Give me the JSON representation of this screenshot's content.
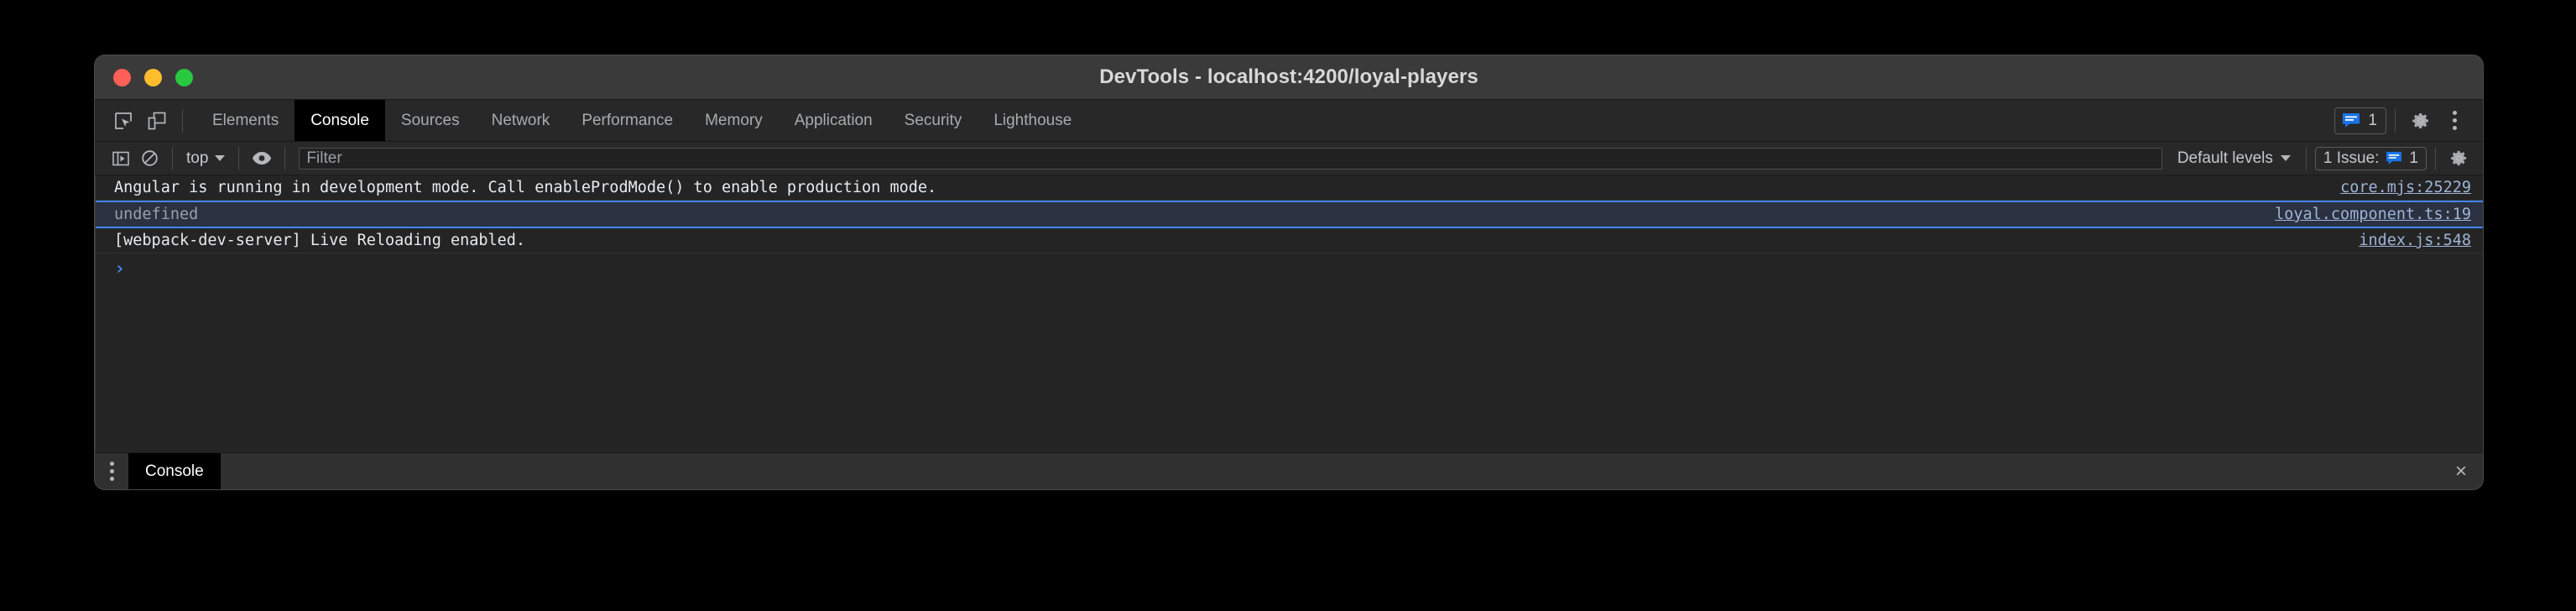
{
  "window": {
    "title": "DevTools - localhost:4200/loyal-players",
    "traffic_lights": [
      {
        "name": "close",
        "color": "#ff5f57"
      },
      {
        "name": "minimize",
        "color": "#ffbd2e"
      },
      {
        "name": "maximize",
        "color": "#28c840"
      }
    ]
  },
  "tabbar": {
    "inspect_icon": "inspect-element-icon",
    "device_icon": "device-toolbar-icon",
    "tabs": [
      {
        "label": "Elements",
        "active": false
      },
      {
        "label": "Console",
        "active": true
      },
      {
        "label": "Sources",
        "active": false
      },
      {
        "label": "Network",
        "active": false
      },
      {
        "label": "Performance",
        "active": false
      },
      {
        "label": "Memory",
        "active": false
      },
      {
        "label": "Application",
        "active": false
      },
      {
        "label": "Security",
        "active": false
      },
      {
        "label": "Lighthouse",
        "active": false
      }
    ],
    "issues_badge_count": "1",
    "settings_icon": "gear-icon",
    "more_icon": "kebab-menu-icon"
  },
  "console_toolbar": {
    "sidebar_icon": "console-sidebar-icon",
    "clear_icon": "clear-console-icon",
    "context": "top",
    "eye_icon": "live-expression-eye-icon",
    "filter_placeholder": "Filter",
    "filter_value": "",
    "levels": "Default levels",
    "issues_label": "1 Issue:",
    "issues_count": "1",
    "settings_icon": "console-settings-gear-icon"
  },
  "messages": [
    {
      "text": "Angular is running in development mode. Call enableProdMode() to enable production mode.",
      "source": "core.mjs:25229",
      "selected": false
    },
    {
      "text": "undefined",
      "source": "loyal.component.ts:19",
      "selected": true
    },
    {
      "text": "[webpack-dev-server] Live Reloading enabled.",
      "source": "index.js:548",
      "selected": false
    }
  ],
  "prompt": {
    "caret": "›",
    "value": ""
  },
  "drawer": {
    "menu_icon": "drawer-kebab-icon",
    "tab_label": "Console",
    "close_label": "×"
  },
  "colors": {
    "accent_blue": "#4285f4",
    "link_blue": "#9db4d8",
    "selected_row_bg": "#2b3140"
  }
}
